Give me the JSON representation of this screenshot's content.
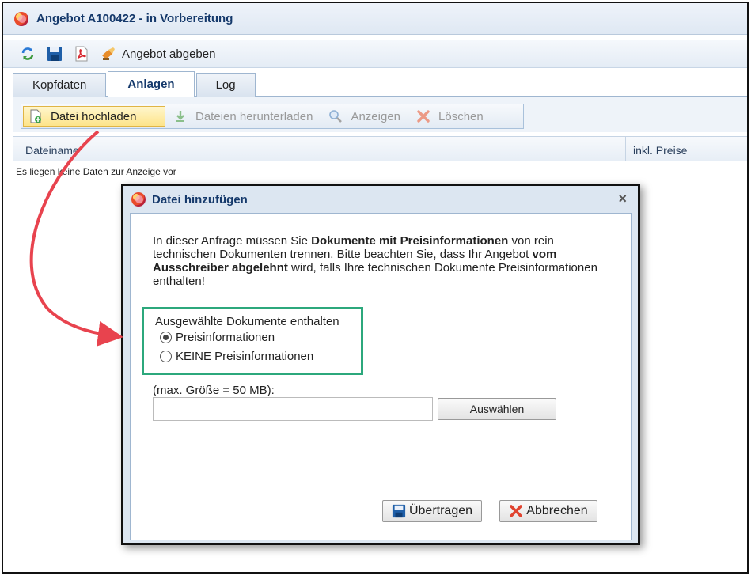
{
  "window": {
    "title": "Angebot A100422 - in Vorbereitung"
  },
  "toolbar": {
    "icons": [
      "refresh-icon",
      "save-icon",
      "pdf-icon",
      "submit-icon"
    ],
    "submit_label": "Angebot abgeben"
  },
  "tabs": [
    {
      "label": "Kopfdaten",
      "active": false
    },
    {
      "label": "Anlagen",
      "active": true
    },
    {
      "label": "Log",
      "active": false
    }
  ],
  "attachments_toolbar": {
    "upload_label": "Datei hochladen",
    "download_label": "Dateien herunterladen",
    "show_label": "Anzeigen",
    "delete_label": "Löschen"
  },
  "grid": {
    "columns": [
      "Dateiname",
      "inkl. Preise"
    ],
    "empty_message": "Es liegen keine Daten zur Anzeige vor"
  },
  "dialog": {
    "title": "Datei hinzufügen",
    "close_glyph": "×",
    "info": {
      "p1": "In dieser Anfrage müssen Sie ",
      "b1": "Dokumente mit Preisinformationen",
      "p2": " von rein technischen Dokumenten trennen. Bitte beachten Sie, dass Ihr Angebot ",
      "b2": "vom Ausschreiber abgelehnt",
      "p3": " wird, falls Ihre technischen Dokumente Preisinformationen enthalten!"
    },
    "choice_legend": "Ausgewählte Dokumente enthalten",
    "options": [
      {
        "label": "Preisinformationen",
        "checked": true
      },
      {
        "label": "KEINE Preisinformationen",
        "checked": false
      }
    ],
    "size_label": "(max. Größe = 50 MB):",
    "file_value": "",
    "choose_label": "Auswählen",
    "submit_label": "Übertragen",
    "cancel_label": "Abbrechen"
  },
  "colors": {
    "highlight_border": "#2ca87c",
    "annotation_arrow": "#e8434e",
    "title_text": "#15396b"
  }
}
